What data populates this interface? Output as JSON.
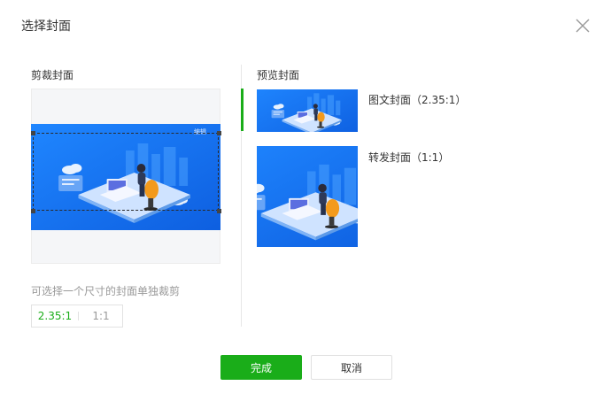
{
  "dialog": {
    "title": "选择封面",
    "close_icon": "close-icon"
  },
  "crop": {
    "label": "剪裁封面",
    "image_badge": "编辑"
  },
  "preview": {
    "label": "预览封面",
    "items": [
      {
        "label": "图文封面（2.35:1）"
      },
      {
        "label": "转发封面（1:1）"
      }
    ]
  },
  "ratio": {
    "hint": "可选择一个尺寸的封面单独裁剪",
    "options": [
      "2.35:1",
      "1:1"
    ],
    "selected": "2.35:1"
  },
  "buttons": {
    "confirm": "完成",
    "cancel": "取消"
  },
  "colors": {
    "accent": "#1aad19",
    "illustration_blue": "#1677ff"
  }
}
